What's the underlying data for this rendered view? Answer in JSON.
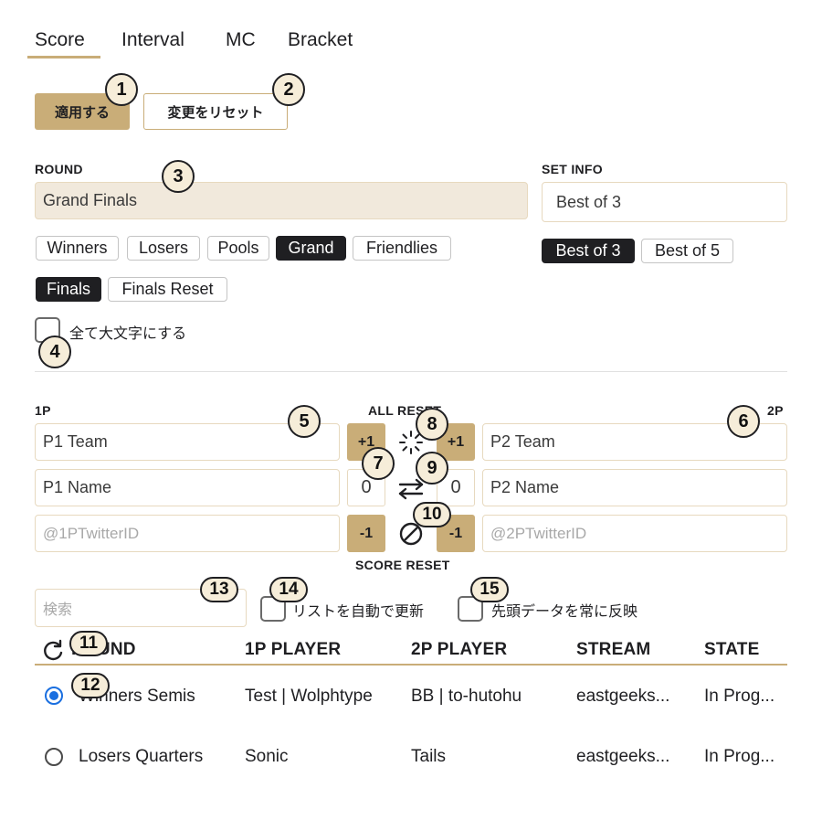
{
  "tabs": [
    "Score",
    "Interval",
    "MC",
    "Bracket"
  ],
  "actions": {
    "apply": "適用する",
    "reset": "変更をリセット"
  },
  "round": {
    "label": "ROUND",
    "value": "Grand Finals",
    "chips_row1": [
      "Winners",
      "Losers",
      "Pools",
      "Grand",
      "Friendlies"
    ],
    "chips_row2": [
      "Finals",
      "Finals Reset"
    ],
    "uppercase_label": "全て大文字にする"
  },
  "set_info": {
    "label": "SET INFO",
    "value": "Best of 3",
    "options": [
      "Best of 3",
      "Best of 5"
    ]
  },
  "players": {
    "p1_label": "1P",
    "p2_label": "2P",
    "all_reset": "ALL RESET",
    "score_reset": "SCORE RESET",
    "p1_team": "P1 Team",
    "p1_name": "P1 Name",
    "p1_twitter_placeholder": "@1PTwitterID",
    "p2_team": "P2 Team",
    "p2_name": "P2 Name",
    "p2_twitter_placeholder": "@2PTwitterID",
    "p1_score": "0",
    "p2_score": "0",
    "plus": "+1",
    "minus": "-1"
  },
  "search": {
    "placeholder": "検索",
    "auto_update": "リストを自動で更新",
    "apply_first": "先頭データを常に反映"
  },
  "table": {
    "headers": [
      "ROUND",
      "1P PLAYER",
      "2P PLAYER",
      "STREAM",
      "STATE"
    ],
    "rows": [
      {
        "round": "Winners Semis",
        "p1": "Test | Wolphtype",
        "p2": "BB | to-hutohu",
        "stream": "eastgeeks...",
        "state": "In Prog..."
      },
      {
        "round": "Losers Quarters",
        "p1": "Sonic",
        "p2": "Tails",
        "stream": "eastgeeks...",
        "state": "In Prog..."
      }
    ]
  },
  "badges": [
    "1",
    "2",
    "3",
    "4",
    "5",
    "6",
    "7",
    "8",
    "9",
    "10",
    "11",
    "12",
    "13",
    "14",
    "15"
  ],
  "colors": {
    "accent": "#c9ad78",
    "accent_light": "#f1e9dc",
    "dark": "#1f1f22",
    "radio": "#1a6fe0"
  },
  "icons": [
    "spinner-icon",
    "swap-icon",
    "ban-icon",
    "refresh-icon"
  ]
}
